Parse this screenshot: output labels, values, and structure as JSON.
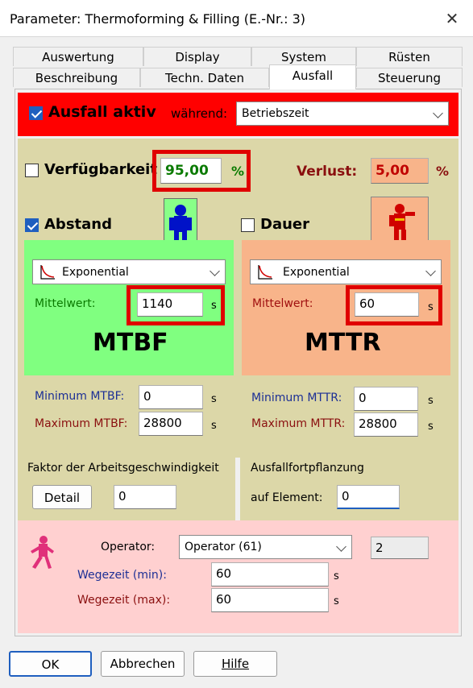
{
  "window": {
    "title": "Parameter: Thermoforming & Filling (E.-Nr.: 3)",
    "close_glyph": "✕"
  },
  "tabs": {
    "row1": [
      "Auswertung",
      "Display",
      "System",
      "Rüsten"
    ],
    "row2": [
      "Beschreibung",
      "Techn. Daten",
      "Ausfall",
      "Steuerung"
    ],
    "active": "Ausfall"
  },
  "ausfall": {
    "label": "Ausfall aktiv",
    "checked": true,
    "waehrend_label": "während:",
    "waehrend_value": "Betriebszeit"
  },
  "verfuegbarkeit": {
    "label": "Verfügbarkeit",
    "checked": false,
    "value": "95,00",
    "unit": "%"
  },
  "verlust": {
    "label": "Verlust:",
    "value": "5,00",
    "unit": "%"
  },
  "abstand": {
    "label": "Abstand",
    "checked": true,
    "distribution": "Exponential",
    "mittelwert_label": "Mittelwert:",
    "mittelwert_value": "1140",
    "unit": "s",
    "big_label": "MTBF",
    "min_label": "Minimum MTBF:",
    "min_value": "0",
    "max_label": "Maximum MTBF:",
    "max_value": "28800"
  },
  "dauer": {
    "label": "Dauer",
    "checked": false,
    "distribution": "Exponential",
    "mittelwert_label": "Mittelwert:",
    "mittelwert_value": "60",
    "unit": "s",
    "big_label": "MTTR",
    "min_label": "Minimum MTTR:",
    "min_value": "0",
    "max_label": "Maximum MTTR:",
    "max_value": "28800"
  },
  "faktor": {
    "label": "Faktor der Arbeitsgeschwindigkeit",
    "detail_button": "Detail",
    "value": "0"
  },
  "fortpflanzung": {
    "label": "Ausfallfortpflanzung",
    "element_label": "auf Element:",
    "element_value": "0"
  },
  "operator": {
    "label": "Operator:",
    "value": "Operator (61)",
    "count": "2",
    "wegezeit_min_label": "Wegezeit (min):",
    "wegezeit_min_value": "60",
    "wegezeit_max_label": "Wegezeit (max):",
    "wegezeit_max_value": "60",
    "unit": "s"
  },
  "buttons": {
    "ok": "OK",
    "abbrechen": "Abbrechen",
    "hilfe": "Hilfe"
  },
  "colors": {
    "red_frame": "#e00000",
    "mtbf_green": "#80ff80",
    "mttr_orange": "#f8b48a",
    "olive": "#dcd7a8",
    "operator_pink": "#ffd0d0",
    "blue_text": "#1c2f95"
  }
}
